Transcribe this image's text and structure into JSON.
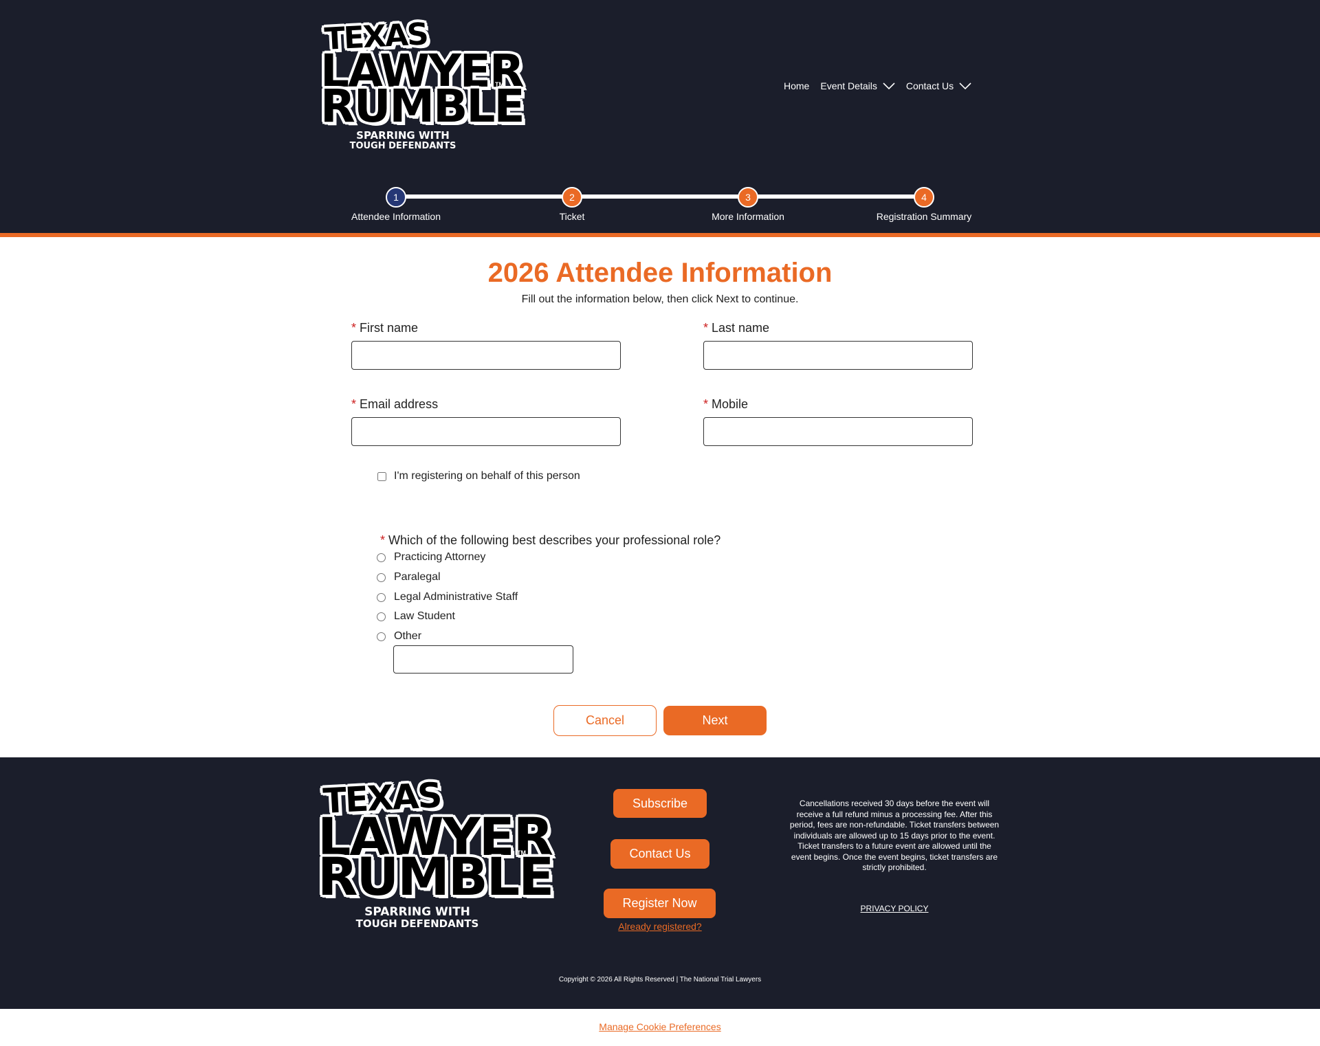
{
  "brand": {
    "word1": "TEXAS",
    "word2": "LAWYER",
    "word3": "RUMBLE",
    "trademark": "TM",
    "tagline1": "SPARRING WITH",
    "tagline2": "TOUGH DEFENDANTS"
  },
  "nav": {
    "home": "Home",
    "event_details": "Event Details",
    "contact_us": "Contact Us"
  },
  "steps": [
    {
      "num": "1",
      "label": "Attendee Information"
    },
    {
      "num": "2",
      "label": "Ticket"
    },
    {
      "num": "3",
      "label": "More Information"
    },
    {
      "num": "4",
      "label": "Registration Summary"
    }
  ],
  "form": {
    "title": "2026 Attendee Information",
    "subtitle": "Fill out the information below, then click Next to continue.",
    "required_mark": "*",
    "first_name_label": "First name",
    "last_name_label": "Last name",
    "email_label": "Email address",
    "mobile_label": "Mobile",
    "first_name_value": "",
    "last_name_value": "",
    "email_value": "",
    "mobile_value": "",
    "behalf_label": "I'm registering on behalf of this person",
    "role_question": "Which of the following best describes your professional role?",
    "role_options": [
      "Practicing Attorney",
      "Paralegal",
      "Legal Administrative Staff",
      "Law Student",
      "Other"
    ],
    "other_value": "",
    "cancel_label": "Cancel",
    "next_label": "Next"
  },
  "footer": {
    "subscribe_label": "Subscribe",
    "contact_label": "Contact Us",
    "register_label": "Register Now",
    "already_label": "Already registered?",
    "policy_text": "Cancellations received 30 days before the event will receive a full refund minus a processing fee. After this period, fees are non-refundable. Ticket transfers between individuals are allowed up to 15 days prior to the event. Ticket transfers to a future event are allowed until the event begins. Once the event begins, ticket transfers are strictly prohibited.",
    "privacy_label": "PRIVACY POLICY",
    "copyright": "Copyright © 2026 All Rights Reserved | The National Trial Lawyers"
  },
  "cookie_label": "Manage Cookie Preferences",
  "colors": {
    "navy": "#1b1e2b",
    "accent": "#ea6a25",
    "step_active": "#253775",
    "required": "#cc1f1f"
  },
  "icons": {
    "nav_dropdown": "chevron-down-icon",
    "logo_scales": "scales-of-justice-icon"
  }
}
